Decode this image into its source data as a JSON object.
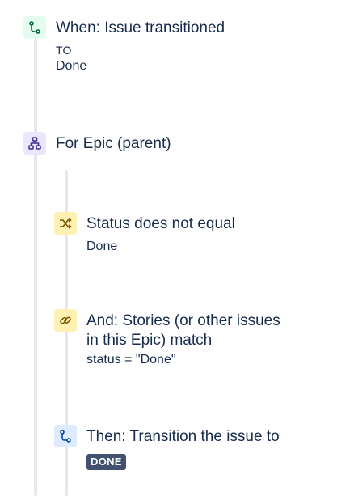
{
  "timeline": {
    "trigger": {
      "title": "When: Issue transitioned",
      "to_label": "TO",
      "status": "Done",
      "icon": "branch-icon",
      "accent": "#e3fcef"
    },
    "branch": {
      "title": "For Epic (parent)",
      "icon": "hierarchy-icon",
      "accent": "#eae6ff"
    },
    "condition1": {
      "title": "Status does not equal",
      "value": "Done",
      "icon": "shuffle-icon",
      "accent": "#fff0b3"
    },
    "condition2": {
      "title_line1": "And: Stories (or other issues",
      "title_line2": "in this Epic) match",
      "query": "status = \"Done\"",
      "icon": "link-icon",
      "accent": "#fff0b3"
    },
    "action": {
      "title": "Then: Transition the issue to",
      "target_status": "DONE",
      "icon": "branch-icon",
      "accent": "#deebff"
    }
  }
}
